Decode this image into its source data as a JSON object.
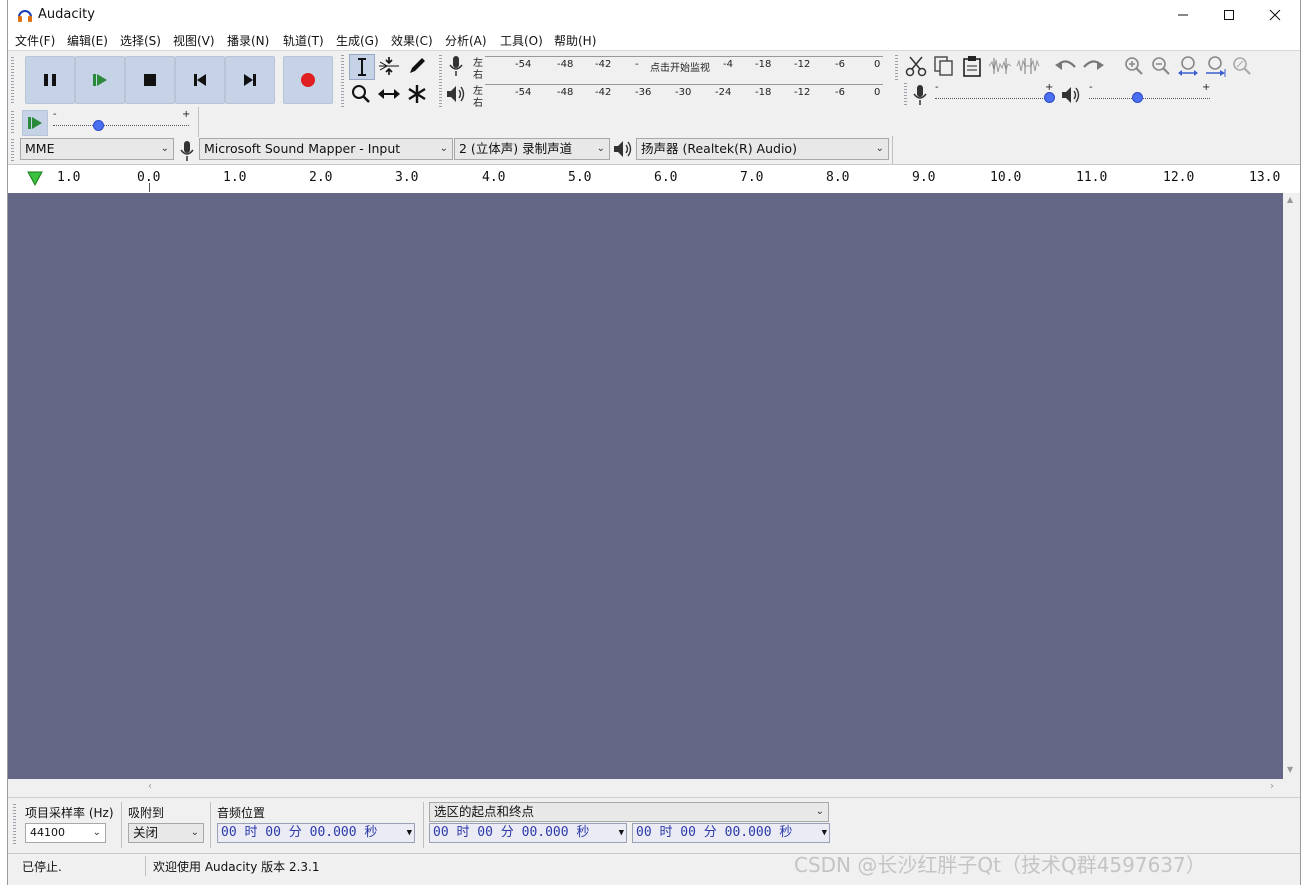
{
  "window": {
    "title": "Audacity",
    "minimize": "—",
    "maximize": "☐",
    "close": "✕"
  },
  "menus": [
    "文件(F)",
    "编辑(E)",
    "选择(S)",
    "视图(V)",
    "播录(N)",
    "轨道(T)",
    "生成(G)",
    "效果(C)",
    "分析(A)",
    "工具(O)",
    "帮助(H)"
  ],
  "transport": {
    "pause": "pause-icon",
    "play": "play-icon",
    "stop": "stop-icon",
    "skip_start": "skip-start-icon",
    "skip_end": "skip-end-icon",
    "record": "record-icon",
    "record_color": "#e02020"
  },
  "meters": {
    "record_lr": [
      "左",
      "右"
    ],
    "playback_lr": [
      "左",
      "右"
    ],
    "record_ticks": [
      "-54",
      "-48",
      "-42",
      "-",
      "点击开始监视",
      "-4",
      "-18",
      "-12",
      "-6",
      "0"
    ],
    "playback_ticks": [
      "-54",
      "-48",
      "-42",
      "-36",
      "-30",
      "-24",
      "-18",
      "-12",
      "-6",
      "0"
    ]
  },
  "mixer": {
    "minus": "-",
    "plus": "+"
  },
  "play_at_speed": {
    "minus": "-",
    "plus": "+"
  },
  "devices": {
    "host": "MME",
    "input": "Microsoft Sound Mapper - Input",
    "channels": "2 (立体声) 录制声道",
    "output": "扬声器 (Realtek(R) Audio)"
  },
  "ruler": {
    "ticks": [
      "1.0",
      "0.0",
      "1.0",
      "2.0",
      "3.0",
      "4.0",
      "5.0",
      "6.0",
      "7.0",
      "8.0",
      "9.0",
      "10.0",
      "11.0",
      "12.0",
      "13.0"
    ]
  },
  "colors": {
    "track_bg": "#646686",
    "button_bg": "#c6d2e6",
    "time_text": "#2b3aa8"
  },
  "selection": {
    "rate_label": "项目采样率 (Hz)",
    "rate_value": "44100",
    "snap_label": "吸附到",
    "snap_value": "关闭",
    "pos_label": "音频位置",
    "pos_value": "00 时 00 分 00.000 秒",
    "range_label": "选区的起点和终点",
    "start_value": "00 时 00 分 00.000 秒",
    "end_value": "00 时 00 分 00.000 秒"
  },
  "status": {
    "state": "已停止.",
    "message": "欢迎使用 Audacity 版本 2.3.1"
  },
  "watermark": "CSDN @长沙红胖子Qt（技术Q群4597637）"
}
